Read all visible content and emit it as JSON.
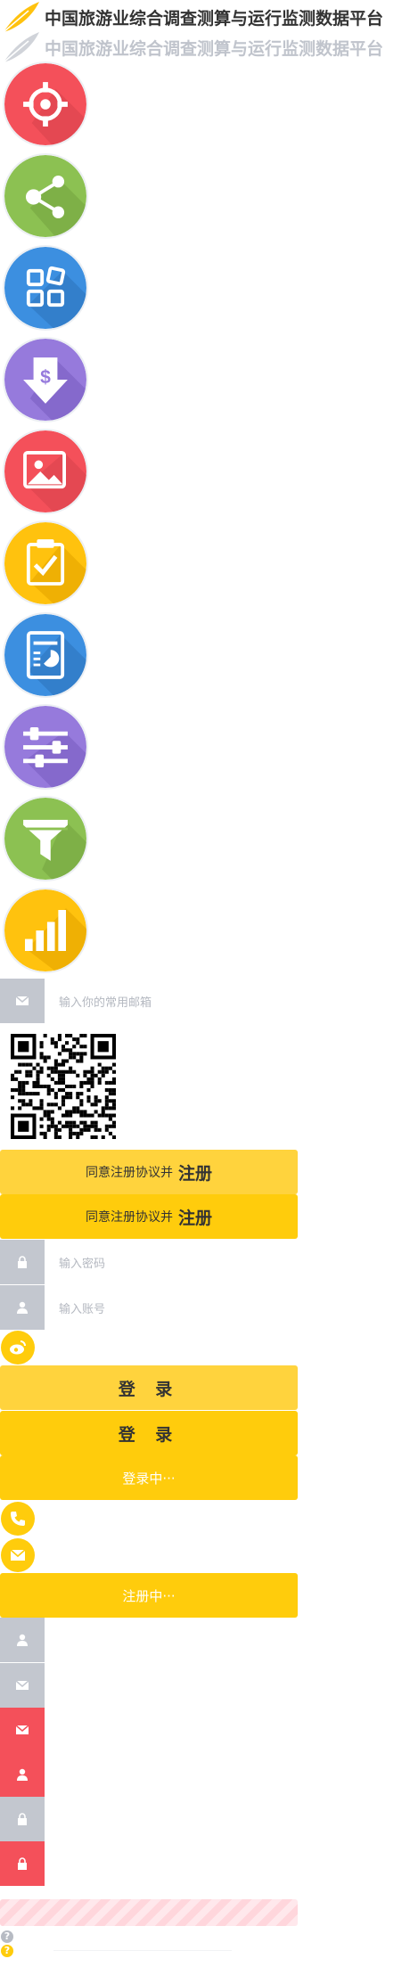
{
  "header": {
    "title": "中国旅游业综合调查测算与运行监测数据平台",
    "title_faded": "中国旅游业综合调查测算与运行监测数据平台"
  },
  "icons": [
    {
      "name": "target-icon",
      "color": "#f4505a"
    },
    {
      "name": "share-icon",
      "color": "#8cc152"
    },
    {
      "name": "apps-grid-icon",
      "color": "#3c8fe0"
    },
    {
      "name": "download-dollar-icon",
      "color": "#967adc"
    },
    {
      "name": "image-icon",
      "color": "#f4505a"
    },
    {
      "name": "clipboard-check-icon",
      "color": "#ffc20e"
    },
    {
      "name": "report-chart-icon",
      "color": "#3c8fe0"
    },
    {
      "name": "sliders-icon",
      "color": "#967adc"
    },
    {
      "name": "filter-icon",
      "color": "#8cc152"
    },
    {
      "name": "bar-chart-icon",
      "color": "#ffc20e"
    }
  ],
  "form": {
    "email_placeholder": "输入你的常用邮箱",
    "agree_text": "同意注册协议并",
    "register_label": "注册",
    "password_placeholder": "输入密码",
    "account_placeholder": "输入账号",
    "login_label": "登 录",
    "logging_in": "登录中···",
    "registering": "注册中···"
  },
  "colors": {
    "accent_yellow": "#ffcc0c",
    "accent_yellow_light": "#ffd33d",
    "gray_side": "#c3c7cf",
    "error_red": "#f4505a"
  }
}
